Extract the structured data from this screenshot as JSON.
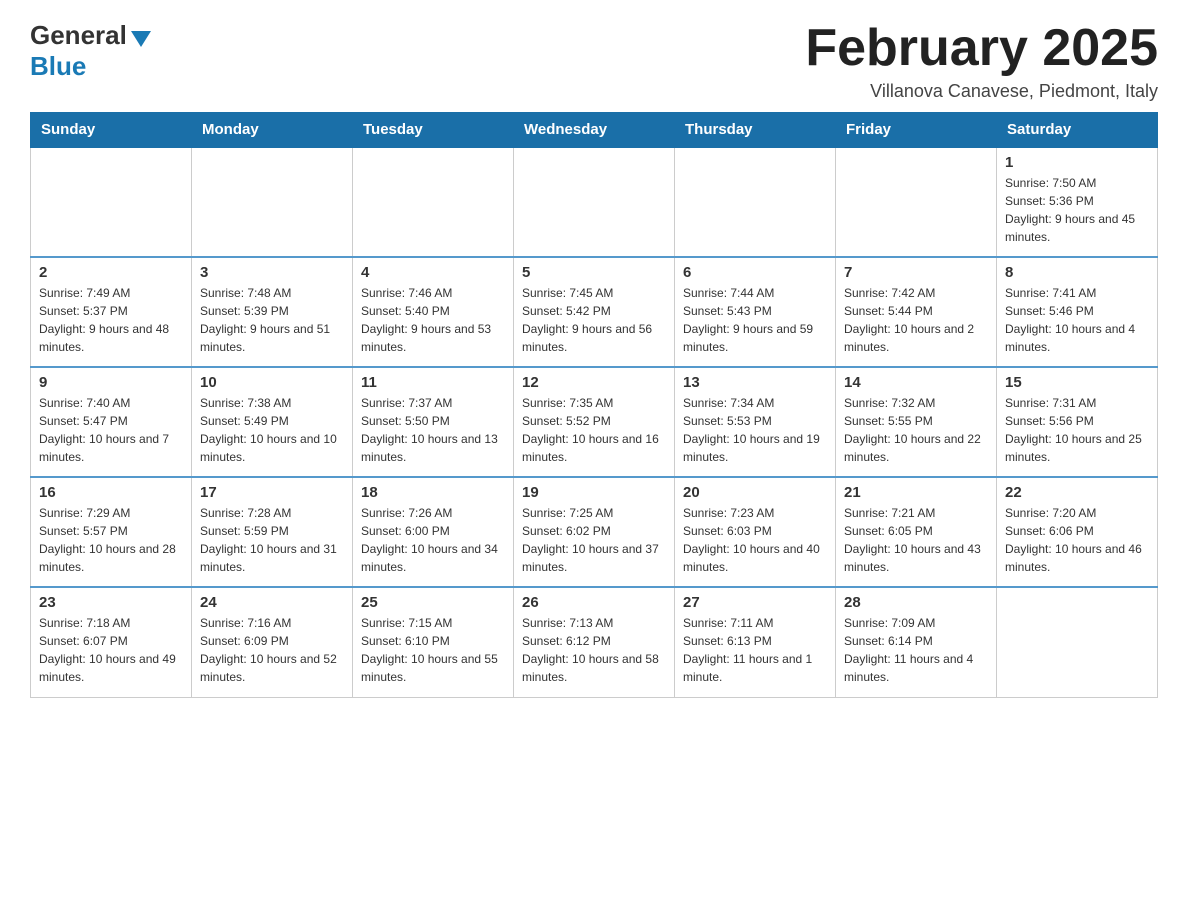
{
  "header": {
    "logo_general": "General",
    "logo_blue": "Blue",
    "title": "February 2025",
    "subtitle": "Villanova Canavese, Piedmont, Italy"
  },
  "weekdays": [
    "Sunday",
    "Monday",
    "Tuesday",
    "Wednesday",
    "Thursday",
    "Friday",
    "Saturday"
  ],
  "weeks": [
    [
      {
        "day": "",
        "info": ""
      },
      {
        "day": "",
        "info": ""
      },
      {
        "day": "",
        "info": ""
      },
      {
        "day": "",
        "info": ""
      },
      {
        "day": "",
        "info": ""
      },
      {
        "day": "",
        "info": ""
      },
      {
        "day": "1",
        "info": "Sunrise: 7:50 AM\nSunset: 5:36 PM\nDaylight: 9 hours and 45 minutes."
      }
    ],
    [
      {
        "day": "2",
        "info": "Sunrise: 7:49 AM\nSunset: 5:37 PM\nDaylight: 9 hours and 48 minutes."
      },
      {
        "day": "3",
        "info": "Sunrise: 7:48 AM\nSunset: 5:39 PM\nDaylight: 9 hours and 51 minutes."
      },
      {
        "day": "4",
        "info": "Sunrise: 7:46 AM\nSunset: 5:40 PM\nDaylight: 9 hours and 53 minutes."
      },
      {
        "day": "5",
        "info": "Sunrise: 7:45 AM\nSunset: 5:42 PM\nDaylight: 9 hours and 56 minutes."
      },
      {
        "day": "6",
        "info": "Sunrise: 7:44 AM\nSunset: 5:43 PM\nDaylight: 9 hours and 59 minutes."
      },
      {
        "day": "7",
        "info": "Sunrise: 7:42 AM\nSunset: 5:44 PM\nDaylight: 10 hours and 2 minutes."
      },
      {
        "day": "8",
        "info": "Sunrise: 7:41 AM\nSunset: 5:46 PM\nDaylight: 10 hours and 4 minutes."
      }
    ],
    [
      {
        "day": "9",
        "info": "Sunrise: 7:40 AM\nSunset: 5:47 PM\nDaylight: 10 hours and 7 minutes."
      },
      {
        "day": "10",
        "info": "Sunrise: 7:38 AM\nSunset: 5:49 PM\nDaylight: 10 hours and 10 minutes."
      },
      {
        "day": "11",
        "info": "Sunrise: 7:37 AM\nSunset: 5:50 PM\nDaylight: 10 hours and 13 minutes."
      },
      {
        "day": "12",
        "info": "Sunrise: 7:35 AM\nSunset: 5:52 PM\nDaylight: 10 hours and 16 minutes."
      },
      {
        "day": "13",
        "info": "Sunrise: 7:34 AM\nSunset: 5:53 PM\nDaylight: 10 hours and 19 minutes."
      },
      {
        "day": "14",
        "info": "Sunrise: 7:32 AM\nSunset: 5:55 PM\nDaylight: 10 hours and 22 minutes."
      },
      {
        "day": "15",
        "info": "Sunrise: 7:31 AM\nSunset: 5:56 PM\nDaylight: 10 hours and 25 minutes."
      }
    ],
    [
      {
        "day": "16",
        "info": "Sunrise: 7:29 AM\nSunset: 5:57 PM\nDaylight: 10 hours and 28 minutes."
      },
      {
        "day": "17",
        "info": "Sunrise: 7:28 AM\nSunset: 5:59 PM\nDaylight: 10 hours and 31 minutes."
      },
      {
        "day": "18",
        "info": "Sunrise: 7:26 AM\nSunset: 6:00 PM\nDaylight: 10 hours and 34 minutes."
      },
      {
        "day": "19",
        "info": "Sunrise: 7:25 AM\nSunset: 6:02 PM\nDaylight: 10 hours and 37 minutes."
      },
      {
        "day": "20",
        "info": "Sunrise: 7:23 AM\nSunset: 6:03 PM\nDaylight: 10 hours and 40 minutes."
      },
      {
        "day": "21",
        "info": "Sunrise: 7:21 AM\nSunset: 6:05 PM\nDaylight: 10 hours and 43 minutes."
      },
      {
        "day": "22",
        "info": "Sunrise: 7:20 AM\nSunset: 6:06 PM\nDaylight: 10 hours and 46 minutes."
      }
    ],
    [
      {
        "day": "23",
        "info": "Sunrise: 7:18 AM\nSunset: 6:07 PM\nDaylight: 10 hours and 49 minutes."
      },
      {
        "day": "24",
        "info": "Sunrise: 7:16 AM\nSunset: 6:09 PM\nDaylight: 10 hours and 52 minutes."
      },
      {
        "day": "25",
        "info": "Sunrise: 7:15 AM\nSunset: 6:10 PM\nDaylight: 10 hours and 55 minutes."
      },
      {
        "day": "26",
        "info": "Sunrise: 7:13 AM\nSunset: 6:12 PM\nDaylight: 10 hours and 58 minutes."
      },
      {
        "day": "27",
        "info": "Sunrise: 7:11 AM\nSunset: 6:13 PM\nDaylight: 11 hours and 1 minute."
      },
      {
        "day": "28",
        "info": "Sunrise: 7:09 AM\nSunset: 6:14 PM\nDaylight: 11 hours and 4 minutes."
      },
      {
        "day": "",
        "info": ""
      }
    ]
  ]
}
